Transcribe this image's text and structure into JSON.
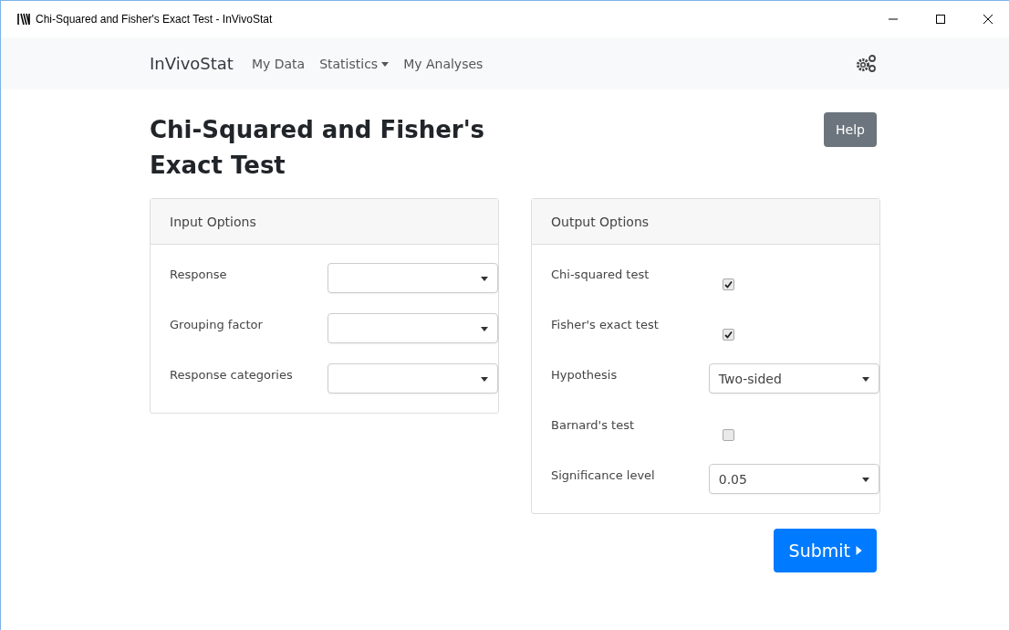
{
  "window": {
    "title": "Chi-Squared and Fisher's Exact Test - InVivoStat"
  },
  "navbar": {
    "brand": "InVivoStat",
    "items": [
      {
        "label": "My Data",
        "dropdown": false
      },
      {
        "label": "Statistics",
        "dropdown": true
      },
      {
        "label": "My Analyses",
        "dropdown": false
      }
    ]
  },
  "page": {
    "title": "Chi-Squared and Fisher's Exact Test",
    "help_button": "Help"
  },
  "input_options": {
    "title": "Input Options",
    "rows": [
      {
        "kind": "select",
        "label": "Response"
      },
      {
        "kind": "select",
        "label": "Grouping factor"
      },
      {
        "kind": "select",
        "label": "Response categories"
      }
    ]
  },
  "output_options": {
    "title": "Output Options",
    "rows": [
      {
        "kind": "checkbox",
        "label": "Chi-squared test",
        "checked": true
      },
      {
        "kind": "checkbox",
        "label": "Fisher's exact test",
        "checked": true
      },
      {
        "kind": "select",
        "label": "Hypothesis",
        "value": "Two-sided"
      },
      {
        "kind": "checkbox",
        "label": "Barnard's test",
        "checked": false
      },
      {
        "kind": "select",
        "label": "Significance level",
        "value": "0.05"
      }
    ]
  },
  "submit_button": "Submit"
}
